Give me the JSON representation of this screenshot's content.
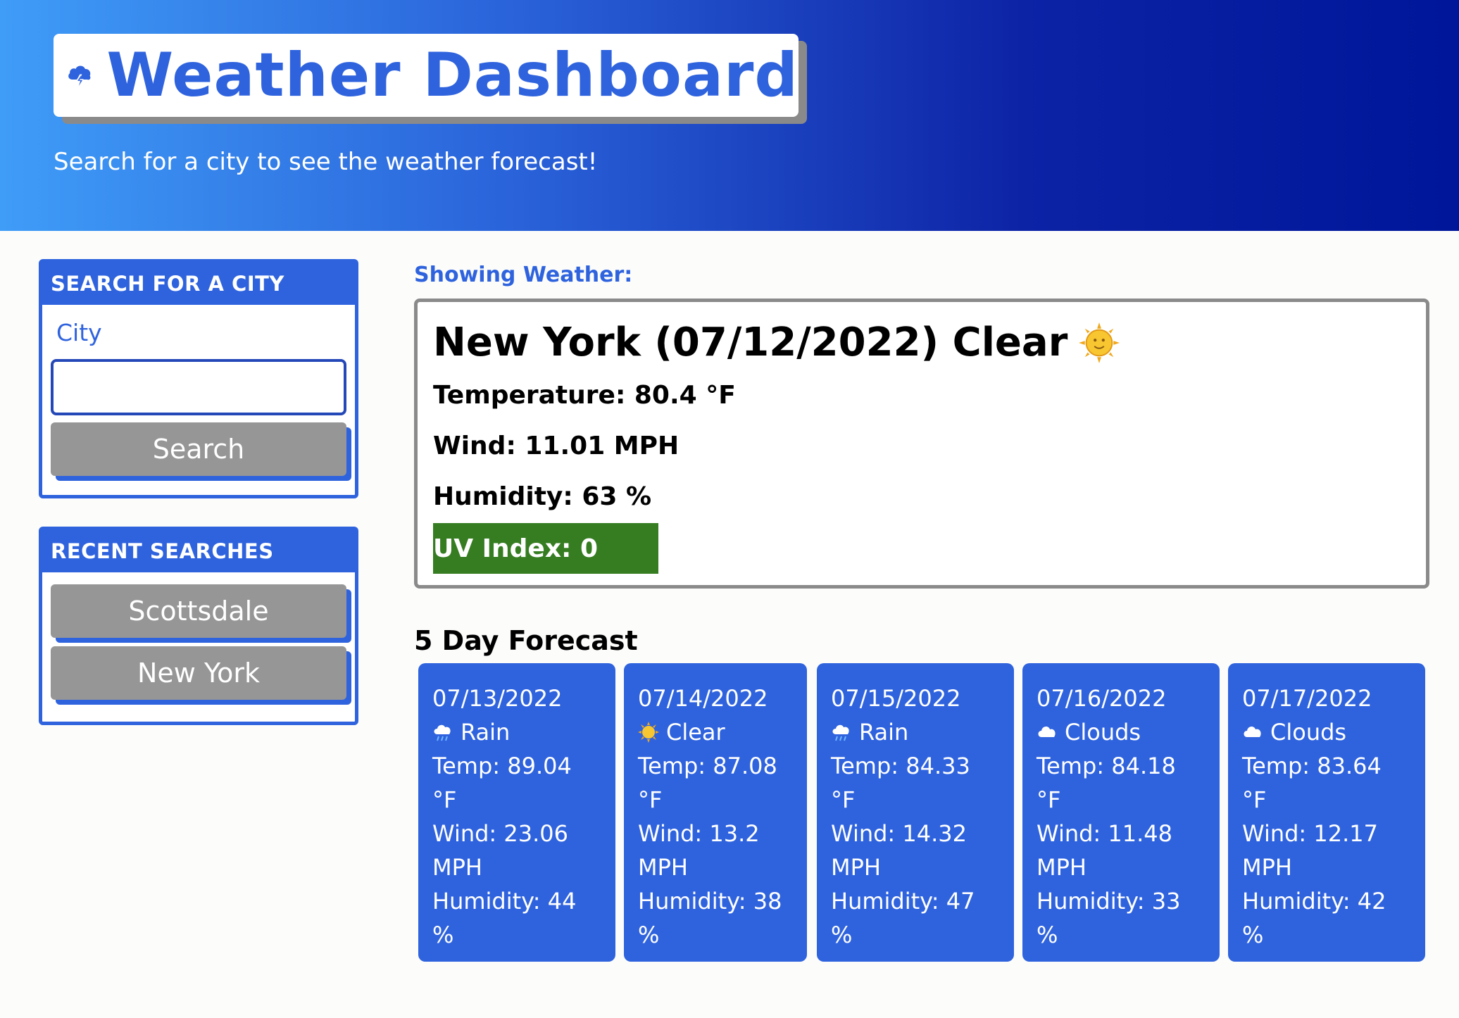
{
  "header": {
    "title": "Weather Dashboard",
    "subtitle": "Search for a city to see the weather forecast!",
    "icon": "storm-cloud-icon",
    "gradient_colors": [
      "#3f9cf7",
      "#2a63da",
      "#00169a"
    ]
  },
  "search_panel": {
    "heading": "SEARCH FOR A CITY",
    "city_label": "City",
    "city_value": "",
    "search_label": "Search"
  },
  "recent_panel": {
    "heading": "RECENT SEARCHES",
    "items": [
      "Scottsdale",
      "New York"
    ]
  },
  "current": {
    "showing_label": "Showing Weather:",
    "title": "New York (07/12/2022) Clear",
    "icon": "sun-icon",
    "temperature": "Temperature: 80.4 °F",
    "wind": "Wind: 11.01 MPH",
    "humidity": "Humidity: 63 %",
    "uv": "UV Index: 0",
    "uv_color": "#367d22"
  },
  "forecast": {
    "title": "5 Day Forecast",
    "days": [
      {
        "date": "07/13/2022",
        "icon": "rain-cloud-icon",
        "condition": "Rain",
        "temp": "Temp: 89.04 °F",
        "wind": "Wind: 23.06 MPH",
        "humidity": "Humidity: 44 %"
      },
      {
        "date": "07/14/2022",
        "icon": "sun-icon",
        "condition": "Clear",
        "temp": "Temp: 87.08 °F",
        "wind": "Wind: 13.2 MPH",
        "humidity": "Humidity: 38 %"
      },
      {
        "date": "07/15/2022",
        "icon": "rain-cloud-icon",
        "condition": "Rain",
        "temp": "Temp: 84.33 °F",
        "wind": "Wind: 14.32 MPH",
        "humidity": "Humidity: 47 %"
      },
      {
        "date": "07/16/2022",
        "icon": "cloud-icon",
        "condition": "Clouds",
        "temp": "Temp: 84.18 °F",
        "wind": "Wind: 11.48 MPH",
        "humidity": "Humidity: 33 %"
      },
      {
        "date": "07/17/2022",
        "icon": "cloud-icon",
        "condition": "Clouds",
        "temp": "Temp: 83.64 °F",
        "wind": "Wind: 12.17 MPH",
        "humidity": "Humidity: 42 %"
      }
    ]
  },
  "colors": {
    "accent": "#2f63de",
    "button_gray": "#969696",
    "border_gray": "#8a8a8a"
  }
}
